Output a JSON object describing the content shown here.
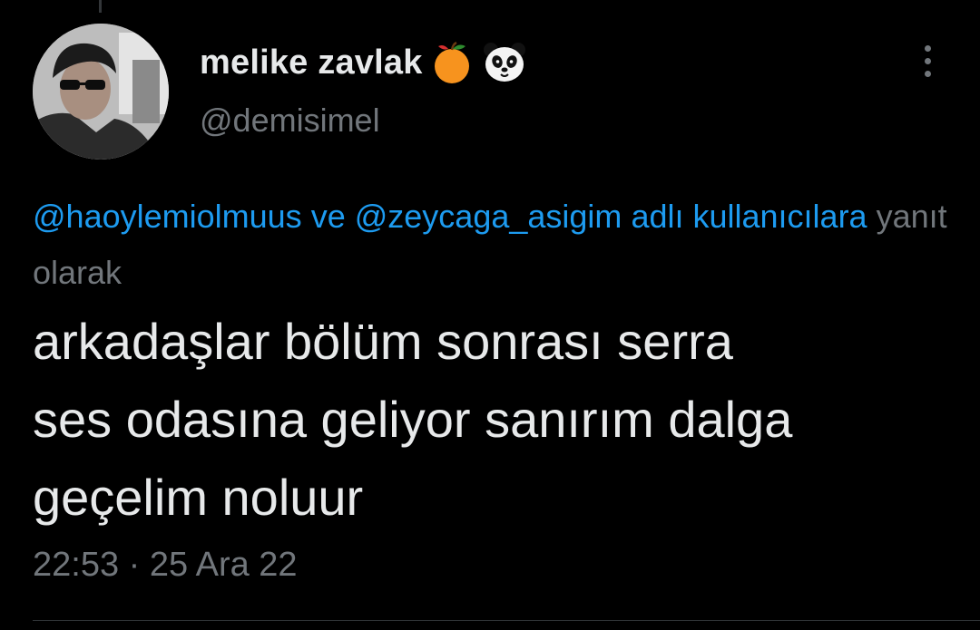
{
  "author": {
    "display_name": "melike zavlak",
    "handle": "@demisimel",
    "name_emojis": [
      "orange-emoji",
      "panda-emoji"
    ]
  },
  "reply_context": {
    "mention_1": "@haoylemiolmuus",
    "conjunction": "ve",
    "mention_2": "@zeycaga_asigim",
    "mention_suffix": "adlı kullanıcılara",
    "tail": "yanıt olarak"
  },
  "tweet": {
    "lines": [
      "arkadaşlar bölüm sonrası serra",
      "ses odasına geliyor sanırım dalga",
      "geçelim noluur"
    ],
    "time": "22:53",
    "separator": "·",
    "date": "25 Ara 22"
  },
  "colors": {
    "background": "#000000",
    "text": "#e7e9ea",
    "secondary": "#71767b",
    "link": "#1d9bf0"
  },
  "icons": {
    "more": "more-vertical-icon"
  }
}
